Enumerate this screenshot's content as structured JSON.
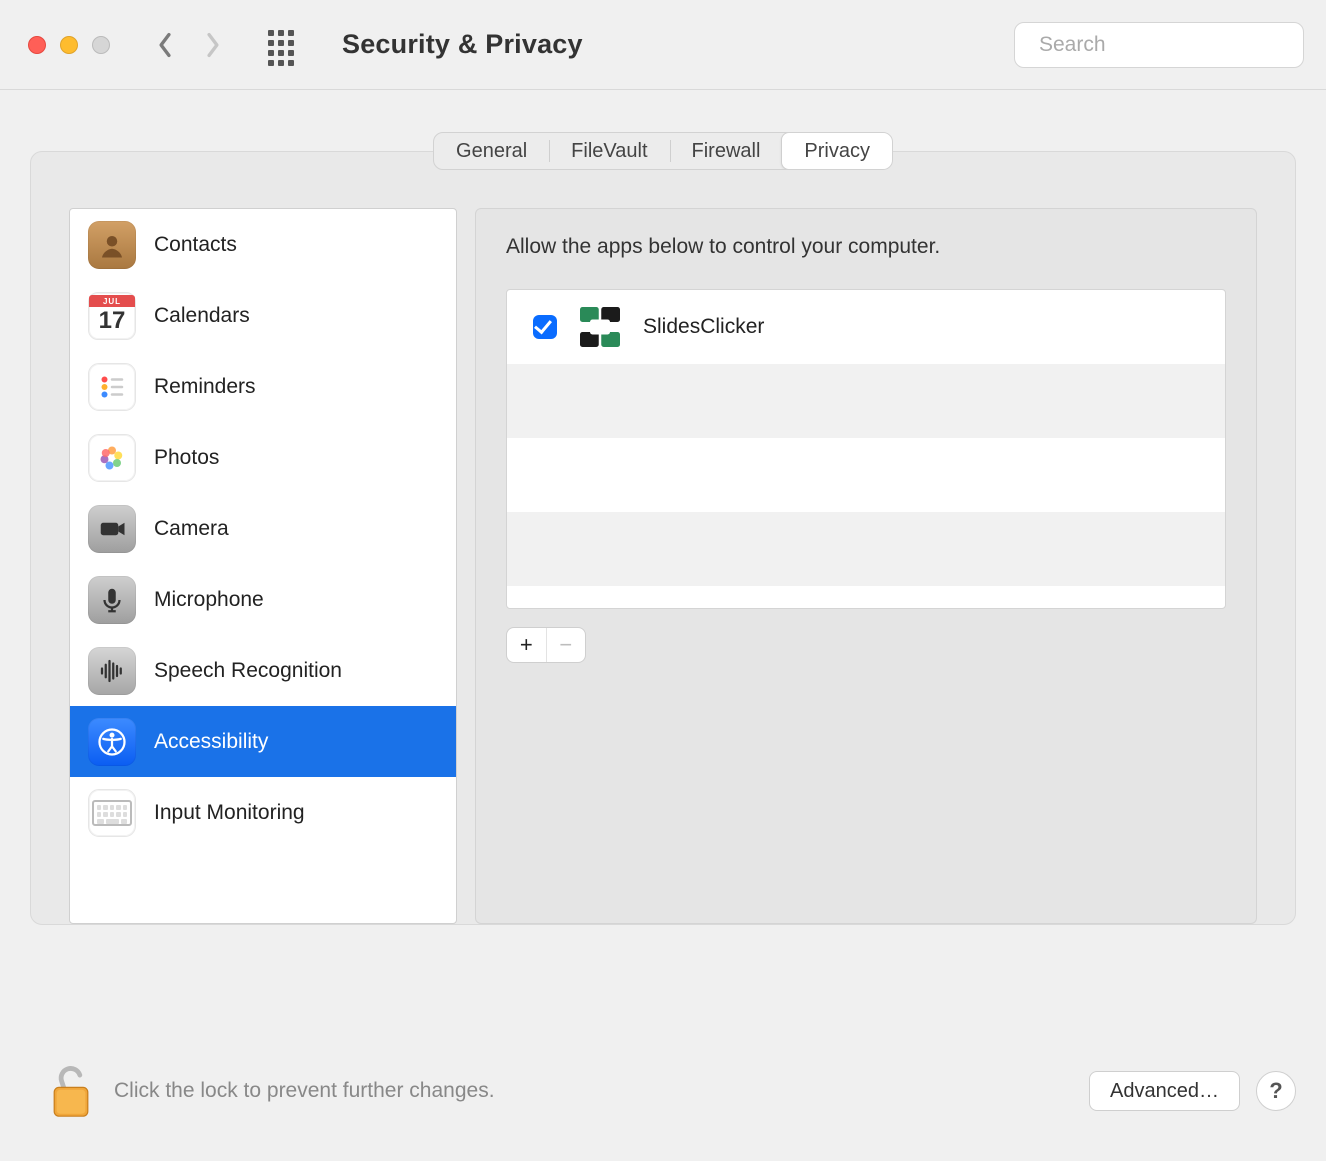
{
  "window": {
    "title": "Security & Privacy"
  },
  "search": {
    "placeholder": "Search"
  },
  "tabs": {
    "general": "General",
    "filevault": "FileVault",
    "firewall": "Firewall",
    "privacy": "Privacy"
  },
  "sidebar": {
    "contacts": "Contacts",
    "calendars": "Calendars",
    "calendarDay": "17",
    "calendarMonth": "JUL",
    "reminders": "Reminders",
    "photos": "Photos",
    "camera": "Camera",
    "microphone": "Microphone",
    "speech": "Speech Recognition",
    "accessibility": "Accessibility",
    "inputMonitoring": "Input Monitoring"
  },
  "rpane": {
    "heading": "Allow the apps below to control your computer.",
    "apps": [
      {
        "name": "SlidesClicker",
        "checked": true
      }
    ]
  },
  "footer": {
    "lockText": "Click the lock to prevent further changes.",
    "advanced": "Advanced…",
    "help": "?"
  },
  "symbols": {
    "plus": "+",
    "minus": "−"
  }
}
